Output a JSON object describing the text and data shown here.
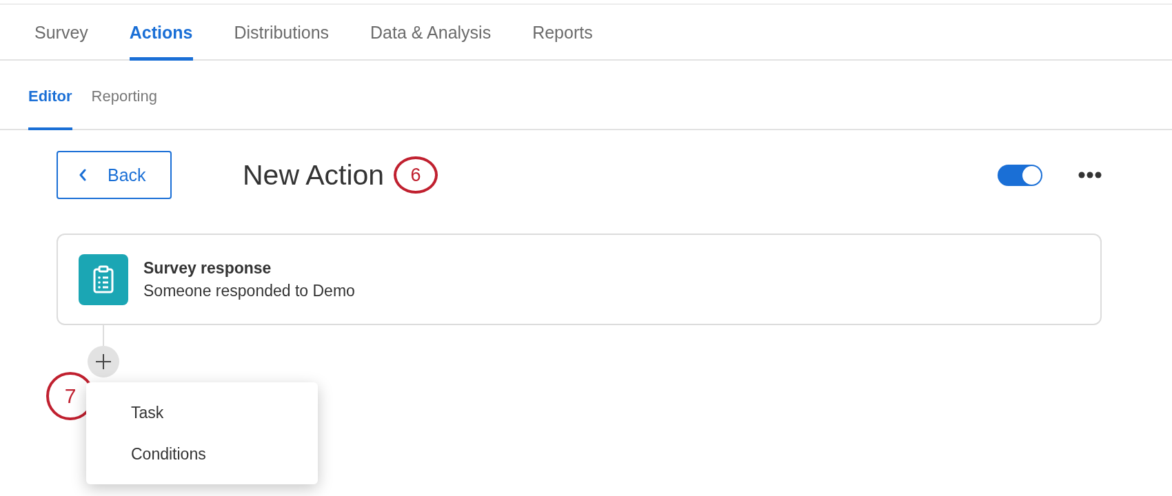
{
  "main_tabs": [
    {
      "label": "Survey",
      "selected": false
    },
    {
      "label": "Actions",
      "selected": true
    },
    {
      "label": "Distributions",
      "selected": false
    },
    {
      "label": "Data & Analysis",
      "selected": false
    },
    {
      "label": "Reports",
      "selected": false
    }
  ],
  "sub_tabs": [
    {
      "label": "Editor",
      "selected": true
    },
    {
      "label": "Reporting",
      "selected": false
    }
  ],
  "header": {
    "back_button": "Back",
    "title": "New Action",
    "title_callout": "6",
    "enabled": true
  },
  "trigger_card": {
    "title": "Survey response",
    "description": "Someone responded to Demo"
  },
  "add_menu": {
    "callout": "7",
    "items": [
      "Task",
      "Conditions"
    ]
  }
}
